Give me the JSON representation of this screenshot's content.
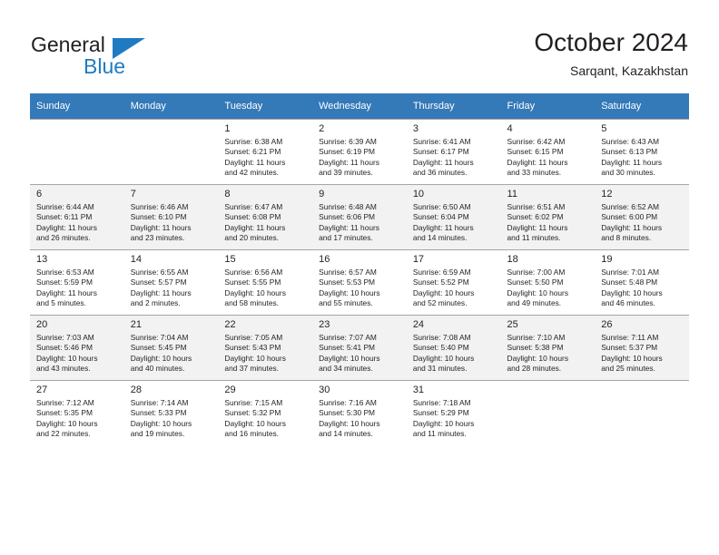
{
  "brand": {
    "name_part1": "General",
    "name_part2": "Blue",
    "accent_color": "#1f7bc1"
  },
  "header": {
    "title": "October 2024",
    "subtitle": "Sarqant, Kazakhstan"
  },
  "calendar": {
    "header_bg": "#3479b8",
    "weekdays": [
      "Sunday",
      "Monday",
      "Tuesday",
      "Wednesday",
      "Thursday",
      "Friday",
      "Saturday"
    ],
    "weeks": [
      [
        {
          "day": "",
          "sunrise": "",
          "sunset": "",
          "daylight1": "",
          "daylight2": ""
        },
        {
          "day": "",
          "sunrise": "",
          "sunset": "",
          "daylight1": "",
          "daylight2": ""
        },
        {
          "day": "1",
          "sunrise": "Sunrise: 6:38 AM",
          "sunset": "Sunset: 6:21 PM",
          "daylight1": "Daylight: 11 hours",
          "daylight2": "and 42 minutes."
        },
        {
          "day": "2",
          "sunrise": "Sunrise: 6:39 AM",
          "sunset": "Sunset: 6:19 PM",
          "daylight1": "Daylight: 11 hours",
          "daylight2": "and 39 minutes."
        },
        {
          "day": "3",
          "sunrise": "Sunrise: 6:41 AM",
          "sunset": "Sunset: 6:17 PM",
          "daylight1": "Daylight: 11 hours",
          "daylight2": "and 36 minutes."
        },
        {
          "day": "4",
          "sunrise": "Sunrise: 6:42 AM",
          "sunset": "Sunset: 6:15 PM",
          "daylight1": "Daylight: 11 hours",
          "daylight2": "and 33 minutes."
        },
        {
          "day": "5",
          "sunrise": "Sunrise: 6:43 AM",
          "sunset": "Sunset: 6:13 PM",
          "daylight1": "Daylight: 11 hours",
          "daylight2": "and 30 minutes."
        }
      ],
      [
        {
          "day": "6",
          "sunrise": "Sunrise: 6:44 AM",
          "sunset": "Sunset: 6:11 PM",
          "daylight1": "Daylight: 11 hours",
          "daylight2": "and 26 minutes."
        },
        {
          "day": "7",
          "sunrise": "Sunrise: 6:46 AM",
          "sunset": "Sunset: 6:10 PM",
          "daylight1": "Daylight: 11 hours",
          "daylight2": "and 23 minutes."
        },
        {
          "day": "8",
          "sunrise": "Sunrise: 6:47 AM",
          "sunset": "Sunset: 6:08 PM",
          "daylight1": "Daylight: 11 hours",
          "daylight2": "and 20 minutes."
        },
        {
          "day": "9",
          "sunrise": "Sunrise: 6:48 AM",
          "sunset": "Sunset: 6:06 PM",
          "daylight1": "Daylight: 11 hours",
          "daylight2": "and 17 minutes."
        },
        {
          "day": "10",
          "sunrise": "Sunrise: 6:50 AM",
          "sunset": "Sunset: 6:04 PM",
          "daylight1": "Daylight: 11 hours",
          "daylight2": "and 14 minutes."
        },
        {
          "day": "11",
          "sunrise": "Sunrise: 6:51 AM",
          "sunset": "Sunset: 6:02 PM",
          "daylight1": "Daylight: 11 hours",
          "daylight2": "and 11 minutes."
        },
        {
          "day": "12",
          "sunrise": "Sunrise: 6:52 AM",
          "sunset": "Sunset: 6:00 PM",
          "daylight1": "Daylight: 11 hours",
          "daylight2": "and 8 minutes."
        }
      ],
      [
        {
          "day": "13",
          "sunrise": "Sunrise: 6:53 AM",
          "sunset": "Sunset: 5:59 PM",
          "daylight1": "Daylight: 11 hours",
          "daylight2": "and 5 minutes."
        },
        {
          "day": "14",
          "sunrise": "Sunrise: 6:55 AM",
          "sunset": "Sunset: 5:57 PM",
          "daylight1": "Daylight: 11 hours",
          "daylight2": "and 2 minutes."
        },
        {
          "day": "15",
          "sunrise": "Sunrise: 6:56 AM",
          "sunset": "Sunset: 5:55 PM",
          "daylight1": "Daylight: 10 hours",
          "daylight2": "and 58 minutes."
        },
        {
          "day": "16",
          "sunrise": "Sunrise: 6:57 AM",
          "sunset": "Sunset: 5:53 PM",
          "daylight1": "Daylight: 10 hours",
          "daylight2": "and 55 minutes."
        },
        {
          "day": "17",
          "sunrise": "Sunrise: 6:59 AM",
          "sunset": "Sunset: 5:52 PM",
          "daylight1": "Daylight: 10 hours",
          "daylight2": "and 52 minutes."
        },
        {
          "day": "18",
          "sunrise": "Sunrise: 7:00 AM",
          "sunset": "Sunset: 5:50 PM",
          "daylight1": "Daylight: 10 hours",
          "daylight2": "and 49 minutes."
        },
        {
          "day": "19",
          "sunrise": "Sunrise: 7:01 AM",
          "sunset": "Sunset: 5:48 PM",
          "daylight1": "Daylight: 10 hours",
          "daylight2": "and 46 minutes."
        }
      ],
      [
        {
          "day": "20",
          "sunrise": "Sunrise: 7:03 AM",
          "sunset": "Sunset: 5:46 PM",
          "daylight1": "Daylight: 10 hours",
          "daylight2": "and 43 minutes."
        },
        {
          "day": "21",
          "sunrise": "Sunrise: 7:04 AM",
          "sunset": "Sunset: 5:45 PM",
          "daylight1": "Daylight: 10 hours",
          "daylight2": "and 40 minutes."
        },
        {
          "day": "22",
          "sunrise": "Sunrise: 7:05 AM",
          "sunset": "Sunset: 5:43 PM",
          "daylight1": "Daylight: 10 hours",
          "daylight2": "and 37 minutes."
        },
        {
          "day": "23",
          "sunrise": "Sunrise: 7:07 AM",
          "sunset": "Sunset: 5:41 PM",
          "daylight1": "Daylight: 10 hours",
          "daylight2": "and 34 minutes."
        },
        {
          "day": "24",
          "sunrise": "Sunrise: 7:08 AM",
          "sunset": "Sunset: 5:40 PM",
          "daylight1": "Daylight: 10 hours",
          "daylight2": "and 31 minutes."
        },
        {
          "day": "25",
          "sunrise": "Sunrise: 7:10 AM",
          "sunset": "Sunset: 5:38 PM",
          "daylight1": "Daylight: 10 hours",
          "daylight2": "and 28 minutes."
        },
        {
          "day": "26",
          "sunrise": "Sunrise: 7:11 AM",
          "sunset": "Sunset: 5:37 PM",
          "daylight1": "Daylight: 10 hours",
          "daylight2": "and 25 minutes."
        }
      ],
      [
        {
          "day": "27",
          "sunrise": "Sunrise: 7:12 AM",
          "sunset": "Sunset: 5:35 PM",
          "daylight1": "Daylight: 10 hours",
          "daylight2": "and 22 minutes."
        },
        {
          "day": "28",
          "sunrise": "Sunrise: 7:14 AM",
          "sunset": "Sunset: 5:33 PM",
          "daylight1": "Daylight: 10 hours",
          "daylight2": "and 19 minutes."
        },
        {
          "day": "29",
          "sunrise": "Sunrise: 7:15 AM",
          "sunset": "Sunset: 5:32 PM",
          "daylight1": "Daylight: 10 hours",
          "daylight2": "and 16 minutes."
        },
        {
          "day": "30",
          "sunrise": "Sunrise: 7:16 AM",
          "sunset": "Sunset: 5:30 PM",
          "daylight1": "Daylight: 10 hours",
          "daylight2": "and 14 minutes."
        },
        {
          "day": "31",
          "sunrise": "Sunrise: 7:18 AM",
          "sunset": "Sunset: 5:29 PM",
          "daylight1": "Daylight: 10 hours",
          "daylight2": "and 11 minutes."
        },
        {
          "day": "",
          "sunrise": "",
          "sunset": "",
          "daylight1": "",
          "daylight2": ""
        },
        {
          "day": "",
          "sunrise": "",
          "sunset": "",
          "daylight1": "",
          "daylight2": ""
        }
      ]
    ]
  }
}
